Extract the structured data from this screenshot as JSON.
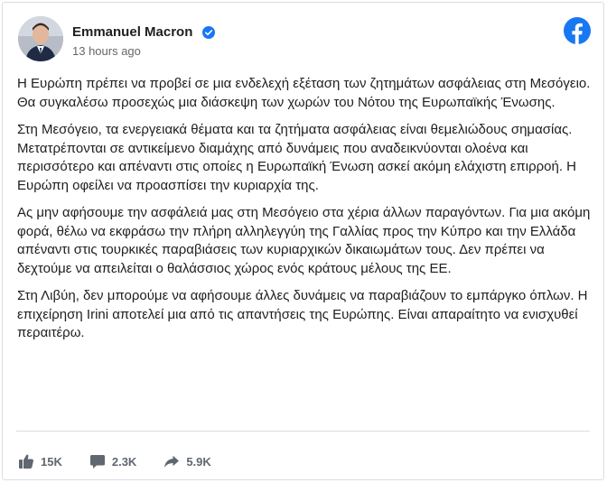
{
  "post": {
    "author": "Emmanuel Macron",
    "verified": true,
    "timestamp": "13 hours ago",
    "paragraphs": [
      "Η Ευρώπη πρέπει να προβεί σε μια ενδελεχή εξέταση των ζητημάτων ασφάλειας στη Μεσόγειο. Θα συγκαλέσω προσεχώς μια διάσκεψη των χωρών του Νότου της Ευρωπαϊκής Ένωσης.",
      "Στη Μεσόγειο, τα ενεργειακά θέματα και τα ζητήματα ασφάλειας είναι θεμελιώδους σημασίας. Μετατρέπονται σε αντικείμενο διαμάχης από δυνάμεις που αναδεικνύονται ολοένα και περισσότερο και απέναντι στις οποίες η Ευρωπαϊκή Ένωση ασκεί ακόμη ελάχιστη επιρροή. Η Ευρώπη οφείλει να προασπίσει την κυριαρχία της.",
      "Ας μην αφήσουμε την ασφάλειά μας στη Μεσόγειο στα χέρια άλλων παραγόντων. Για μια ακόμη φορά, θέλω να εκφράσω την πλήρη αλληλεγγύη της Γαλλίας προς την Κύπρο και την Ελλάδα απέναντι στις τουρκικές παραβιάσεις των κυριαρχικών δικαιωμάτων τους. Δεν πρέπει να δεχτούμε να απειλείται ο θαλάσσιος χώρος ενός κράτους μέλους της ΕΕ.",
      "Στη Λιβύη, δεν μπορούμε να αφήσουμε άλλες δυνάμεις να παραβιάζουν το εμπάργκο όπλων. Η επιχείρηση Irini αποτελεί μια από τις απαντήσεις της Ευρώπης. Είναι απαραίτητο να ενισχυθεί περαιτέρω."
    ]
  },
  "stats": {
    "likes": "15K",
    "comments": "2.3K",
    "shares": "5.9K"
  },
  "icons": {
    "verified": "verified-badge-icon",
    "facebook": "facebook-logo-icon",
    "like": "thumbs-up-icon",
    "comment": "comment-bubble-icon",
    "share": "share-arrow-icon"
  },
  "colors": {
    "facebook_blue": "#1877f2",
    "muted": "#606770"
  }
}
